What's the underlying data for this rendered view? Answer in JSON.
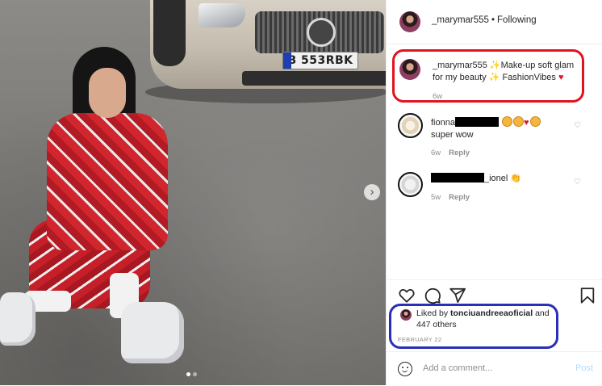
{
  "post": {
    "photo_alt": "",
    "carousel": {
      "total_slides": 2,
      "current_slide": 1
    },
    "car_plate": "B 553RBK"
  },
  "header": {
    "username": "_marymar555",
    "separator": "•",
    "follow_status": "Following"
  },
  "caption": {
    "username": "_marymar555",
    "text_1": "Make-up soft glam",
    "text_2": "for my beauty",
    "text_3": "FashionVibes",
    "time": "6w"
  },
  "comments": [
    {
      "username_visible": "fionna",
      "text": "super wow",
      "time": "6w",
      "reply_label": "Reply"
    },
    {
      "username_visible": "_ionel",
      "text": "",
      "time": "5w",
      "reply_label": "Reply"
    }
  ],
  "actions": {
    "like_icon": "heart-icon",
    "comment_icon": "comment-bubble-icon",
    "share_icon": "paper-plane-icon",
    "save_icon": "bookmark-icon"
  },
  "likes": {
    "prefix": "Liked by",
    "top_liker": "tonciuandreeaoficial",
    "and": "and",
    "others": "447 others"
  },
  "date": "FEBRUARY 22",
  "add_comment": {
    "placeholder": "Add a comment...",
    "post_label": "Post"
  },
  "annotation_colors": {
    "caption_box": "#e0141e",
    "likes_box": "#2a2fb8",
    "link_disabled": "#b3dbff"
  }
}
